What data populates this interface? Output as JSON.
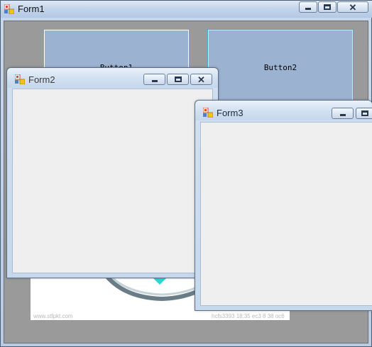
{
  "form1": {
    "title": "Form1",
    "button1_label": "Button1",
    "button2_label": "Button2",
    "close_glyph": "✕",
    "watermark_left": "www.stfpkt.com",
    "watermark_right": "hcfs3393 18:35 ec3 8 38 oc6"
  },
  "form2": {
    "title": "Form2",
    "close_glyph": "✕"
  },
  "form3": {
    "title": "Form3"
  },
  "colors": {
    "button_face": "#9bb3d1",
    "client_bg": "#efefef",
    "mdi_bg": "#9a9a9a",
    "focus_border": "#3ab3c9",
    "diamond": "#2fd6d0"
  },
  "icons": [
    "form-app-icon",
    "minimize-icon",
    "maximize-icon",
    "close-icon"
  ]
}
